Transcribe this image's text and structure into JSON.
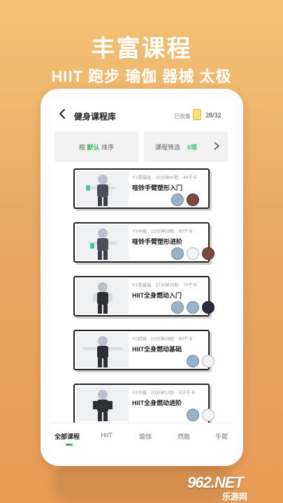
{
  "header": {
    "headline": "丰富课程",
    "subline": "HIIT 跑步 瑜伽 器械 太极"
  },
  "topbar": {
    "title": "健身课程库",
    "collected_label": "已收集",
    "progress": "28/32"
  },
  "filters": {
    "sort_prefix": "按",
    "sort_value": "默认",
    "sort_suffix": "排序",
    "screen_label": "课程筛选",
    "screen_value": "0项"
  },
  "courses": [
    {
      "meta": "Y1零基础 · 10分钟40秒 · 40千卡",
      "name": "哑铃手臂塑形入门"
    },
    {
      "meta": "Y3中级 · 15分钟50秒 · 60千卡",
      "name": "哑铃手臂塑形进阶"
    },
    {
      "meta": "Y1零基础 · 17分钟35秒 · 70千卡",
      "name": "HIIT全身燃动入门"
    },
    {
      "meta": "Y2初级 · 10分钟26秒 · 80千卡",
      "name": "HIIT全身燃动基础"
    },
    {
      "meta": "Y3中级 · 20分钟22秒 · 100千卡",
      "name": "HIIT全身燃动进阶"
    }
  ],
  "tabs": [
    "全部课程",
    "HIIT",
    "瑜伽",
    "燃脂",
    "手臂"
  ],
  "watermark": {
    "main": "962.NET",
    "sub": "乐游网"
  },
  "colors": {
    "accent": "#2fbf5f",
    "background": "#eaa862"
  }
}
